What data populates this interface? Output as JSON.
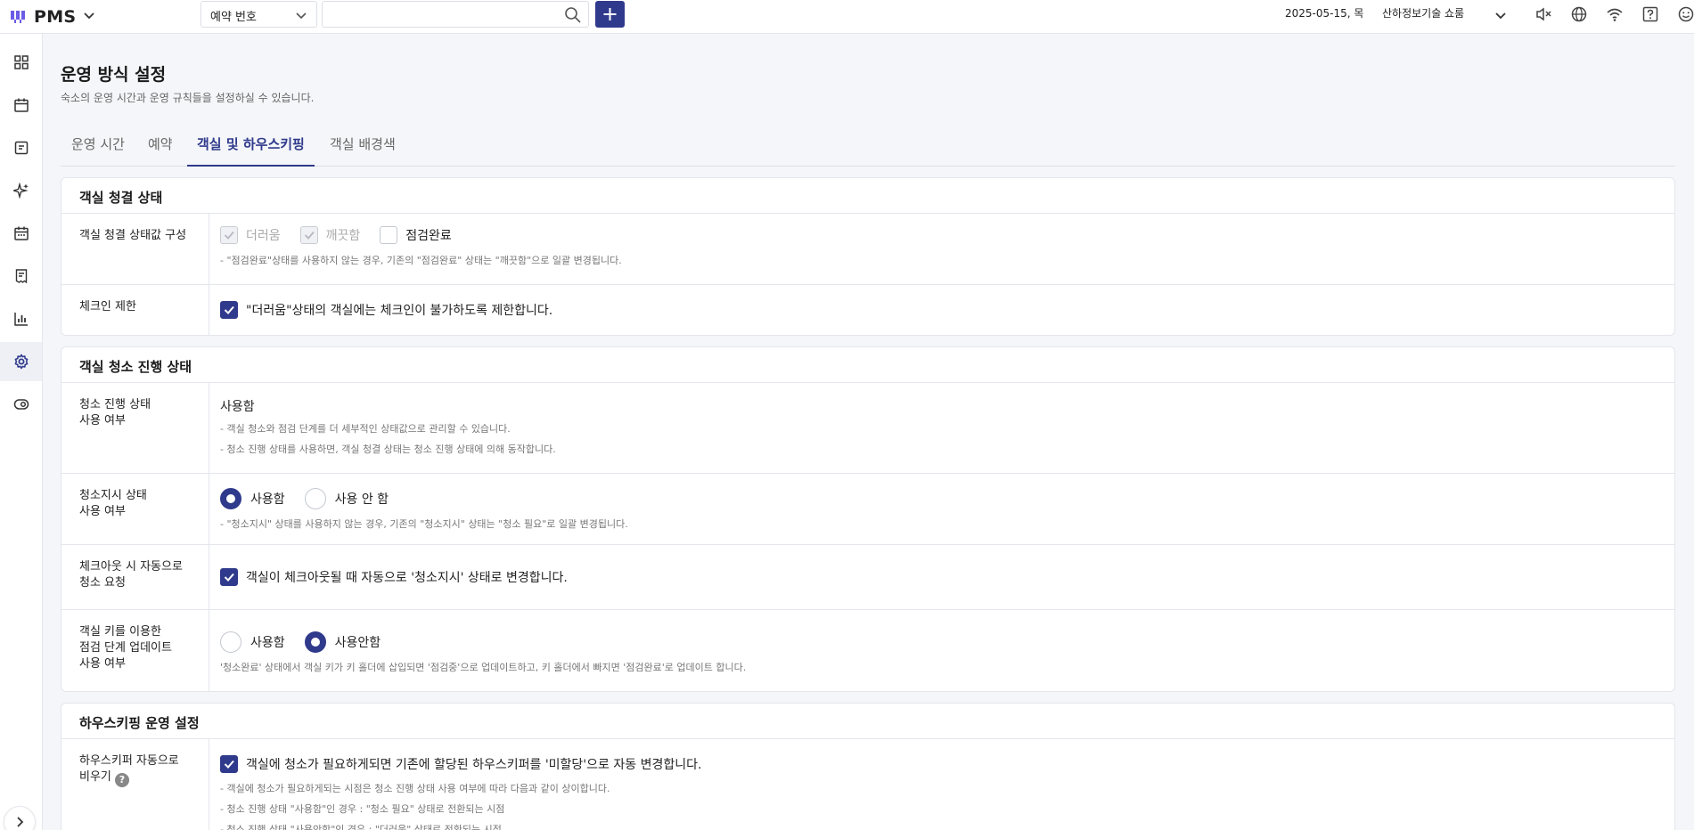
{
  "app": {
    "name": "PMS"
  },
  "topbar": {
    "search_type": "예약 번호",
    "search_placeholder": "",
    "date": "2025-05-15, 목",
    "hotel": "산하정보기술 쇼룸",
    "icons": [
      "mute-icon",
      "globe-icon",
      "wifi-icon",
      "help-icon",
      "emoji-icon"
    ]
  },
  "sidebar": {
    "icons": [
      "dashboard-icon",
      "calendar-icon",
      "notes-icon",
      "sparkle-icon",
      "schedule-icon",
      "receipt-icon",
      "chart-icon",
      "settings-icon",
      "view-icon"
    ],
    "active": "settings-icon"
  },
  "page": {
    "title": "운영 방식 설정",
    "description": "숙소의 운영 시간과 운영 규칙들을 설정하실 수 있습니다."
  },
  "tabs": [
    {
      "label": "운영 시간"
    },
    {
      "label": "예약"
    },
    {
      "label": "객실 및 하우스키핑"
    },
    {
      "label": "객실 배경색"
    }
  ],
  "sections": {
    "clean_status": {
      "title": "객실 청결 상태",
      "config_label": "객실 청결 상태값 구성",
      "opt_dirty": "더러움",
      "opt_clean": "깨끗함",
      "opt_inspected": "점검완료",
      "config_note": "- \"점검완료\"상태를 사용하지 않는 경우, 기존의 \"점검완료\" 상태는 \"깨끗함\"으로 일괄 변경됩니다.",
      "checkin_label": "체크인 제한",
      "checkin_text": "\"더러움\"상태의 객실에는 체크인이 불가하도록 제한합니다."
    },
    "cleaning_progress": {
      "title": "객실 청소 진행 상태",
      "progress_label_1": "청소 진행 상태",
      "progress_label_2": "사용 여부",
      "progress_value": "사용함",
      "progress_note_1": "- 객실 청소와 점검 단계를 더 세부적인 상태값으로 관리할 수 있습니다.",
      "progress_note_2": "- 청소 진행 상태를 사용하면, 객실 청결 상태는 청소 진행 상태에 의해 동작합니다.",
      "instruct_label_1": "청소지시 상태",
      "instruct_label_2": "사용 여부",
      "instruct_yes": "사용함",
      "instruct_no": "사용 안 함",
      "instruct_note": "- \"청소지시\" 상태를 사용하지 않는 경우, 기존의 \"청소지시\" 상태는 \"청소 필요\"로 일괄 변경됩니다.",
      "auto_label_1": "체크아웃 시 자동으로",
      "auto_label_2": "청소 요청",
      "auto_text": "객실이 체크아웃될 때 자동으로 '청소지시' 상태로 변경합니다.",
      "key_label_1": "객실 키를 이용한",
      "key_label_2": "점검 단계 업데이트",
      "key_label_3": "사용 여부",
      "key_yes": "사용함",
      "key_no": "사용안함",
      "key_note": "'청소완료' 상태에서 객실 키가 키 홀더에 삽입되면 '점검중'으로 업데이트하고, 키 홀더에서 빠지면 '점검완료'로 업데이트 합니다."
    },
    "housekeeping": {
      "title": "하우스키핑 운영 설정",
      "auto_label_1": "하우스키퍼 자동으로",
      "auto_label_2": "비우기",
      "auto_text": "객실에 청소가 필요하게되면 기존에 할당된 하우스키퍼를 '미할당'으로 자동 변경합니다.",
      "note_1": "- 객실에 청소가 필요하게되는 시점은 청소 진행 상태 사용 여부에 따라 다음과 같이 상이합니다.",
      "note_2": "- 청소 진행 상태 \"사용함\"인 경우 : \"청소 필요\" 상태로 전환되는 시점",
      "note_3": "- 청소 진행 상태 \"사용안함\"인 경우 : \"더러움\" 상태로 전환되는 시점"
    }
  },
  "colors": {
    "accent": "#303a8c",
    "logo": "#6b5ce7"
  }
}
